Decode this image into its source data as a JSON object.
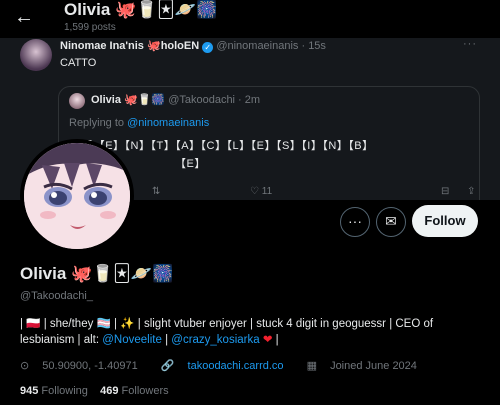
{
  "header": {
    "back_label": "←",
    "name": "Olivia",
    "name_emojis": "🐙🥛🃏🪐🎆",
    "posts": "1,599 posts"
  },
  "banner": {
    "author_name": "Ninomae Ina'nis",
    "author_name_emoji": "🐙",
    "author_suffix": "holoEN",
    "verified_glyph": "✓",
    "author_handle_time": "@ninomaeinanis · 15s",
    "more_label": "···",
    "text": "CATTO",
    "quote": {
      "author_name": "Olivia",
      "author_emojis": "🐙🥛🎆",
      "handle_time": "@Takoodachi · 2m",
      "reply_prefix": "Replying to ",
      "reply_handle": "@ninomaeinanis",
      "letters": "【T】【E】【N】【T】【A】【C】【L】【E】【S】【I】【N】【B】",
      "letters2": "【E】"
    },
    "actions": {
      "retweet": "⇅",
      "like": "♡ 11",
      "bookmark": "⊟",
      "share": "⇪"
    }
  },
  "buttons": {
    "more": "···",
    "message": "✉",
    "follow": "Follow"
  },
  "profile": {
    "name": "Olivia",
    "name_emojis": "🐙🥛🃏🪐🎆",
    "handle": "@Takoodachi_",
    "bio_part1": "| 🇵🇱 | she/they 🏳️‍⚧️ | ✨ | slight vtuber enjoyer | stuck 4 digit in geoguessr | CEO of lesbianism | alt: ",
    "bio_link1": "@Noveelite",
    "bio_sep": " | ",
    "bio_link2": "@crazy_kosiarka",
    "bio_heart": " ❤",
    "bio_end": " |",
    "location_icon": "⊙",
    "location": "50.90900, -1.40971",
    "link_icon": "🔗",
    "website": "takoodachi.carrd.co",
    "joined_icon": "▦",
    "joined": "Joined June 2024",
    "following_count": "945",
    "following_label": "Following",
    "followers_count": "469",
    "followers_label": "Followers"
  }
}
